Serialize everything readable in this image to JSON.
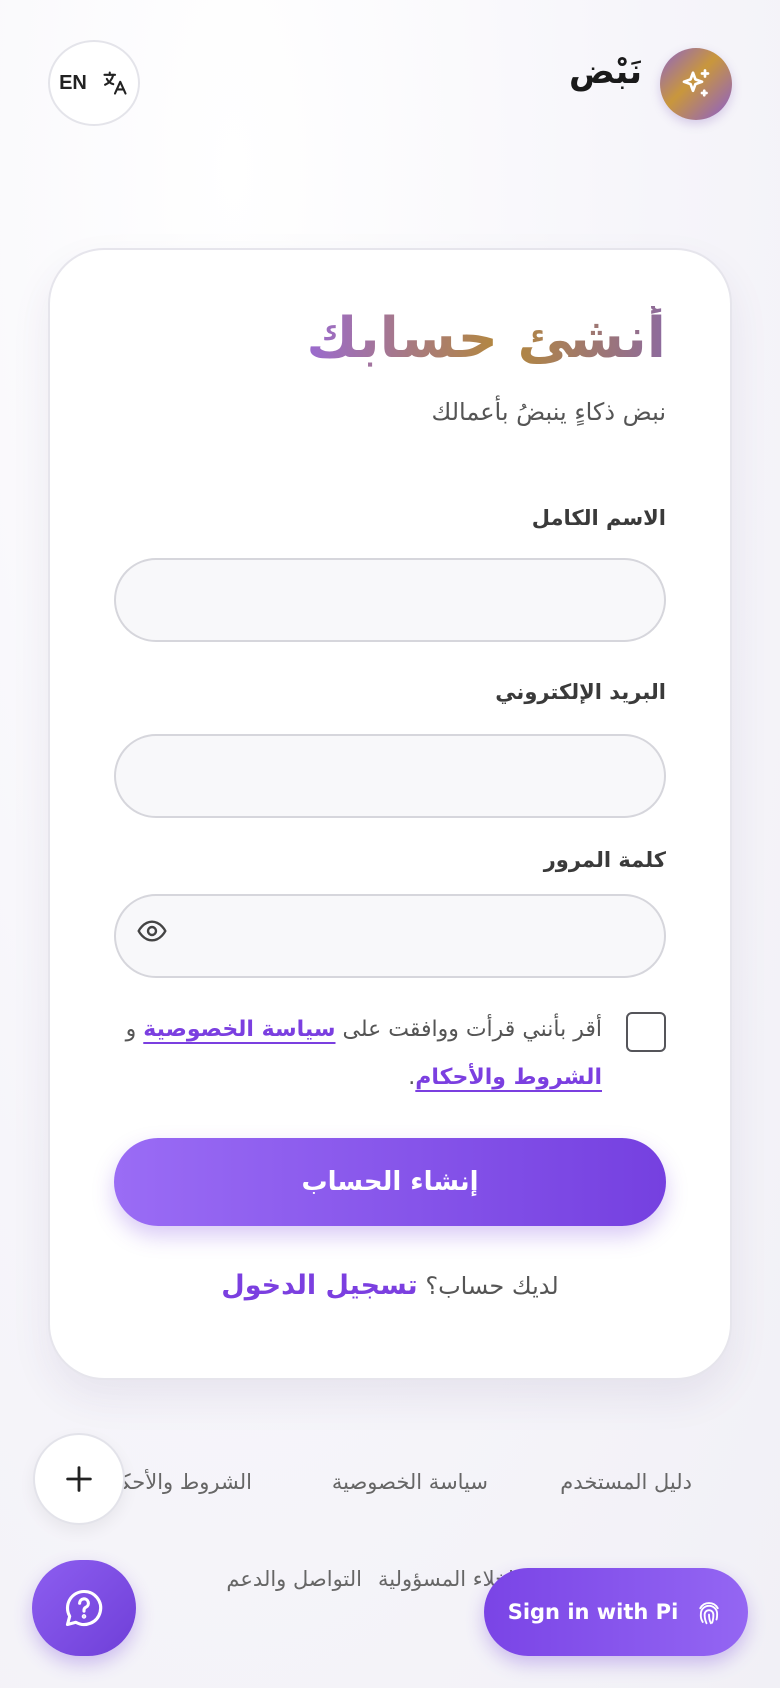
{
  "header": {
    "lang_code": "EN",
    "brand_name": "نَبْض"
  },
  "card": {
    "title": "أنشئ حسابك",
    "subtitle": "نبض ذكاءٍ ينبضُ بأعمالك"
  },
  "form": {
    "full_name_label": "الاسم الكامل",
    "full_name_value": "",
    "email_label": "البريد الإلكتروني",
    "email_value": "",
    "password_label": "كلمة المرور",
    "password_value": "",
    "terms_prefix": "أقر بأنني قرأت ووافقت على",
    "privacy_link": "سياسة الخصوصية",
    "terms_and": "و",
    "terms_link": "الشروط والأحكام",
    "terms_suffix": ".",
    "terms_checked": false,
    "submit_label": "إنشاء الحساب",
    "login_prompt": "لديك حساب؟",
    "login_link": "تسجيل الدخول"
  },
  "footer": {
    "links_row1": [
      "دليل المستخدم",
      "سياسة الخصوصية",
      "الشروط والأحكام"
    ],
    "links_row2": [
      "إخلاء المسؤولية",
      "التواصل والدعم"
    ]
  },
  "actions": {
    "pi_signin_label": "Sign in with Pi"
  },
  "icons": {
    "language": "translate-icon",
    "logo": "sparkles-icon",
    "password_toggle": "eye-icon",
    "add": "plus-icon",
    "help": "chat-question-icon",
    "pi": "fingerprint-icon"
  },
  "colors": {
    "accent": "#7b3fe0",
    "button_gradient_start": "#9a6cf5",
    "button_gradient_end": "#7540e0"
  }
}
